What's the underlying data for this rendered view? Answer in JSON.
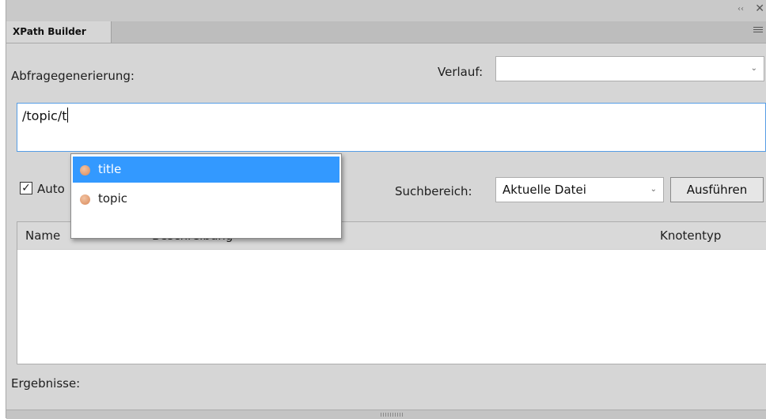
{
  "panel": {
    "tab_title": "XPath Builder",
    "collapse_glyph": "‹‹",
    "close_glyph": "✕"
  },
  "form": {
    "query_label": "Abfragegenerierung:",
    "history_label": "Verlauf:",
    "history_value": "",
    "query_value": "/topic/t",
    "auto_label_visible": "Auto",
    "auto_checked": true,
    "scope_label": "Suchbereich:",
    "scope_value": "Aktuelle Datei",
    "execute_label": "Ausführen"
  },
  "results_table": {
    "columns": [
      "Name",
      "Beschreibung",
      "Knotentyp"
    ],
    "rows": []
  },
  "results_label": "Ergebnisse:",
  "autocomplete": {
    "items": [
      {
        "label": "title",
        "icon": "element-icon",
        "selected": true
      },
      {
        "label": "topic",
        "icon": "element-icon",
        "selected": false
      }
    ]
  },
  "colors": {
    "selection": "#3399ff",
    "focus_border": "#569de5",
    "panel_bg": "#d6d6d6"
  }
}
